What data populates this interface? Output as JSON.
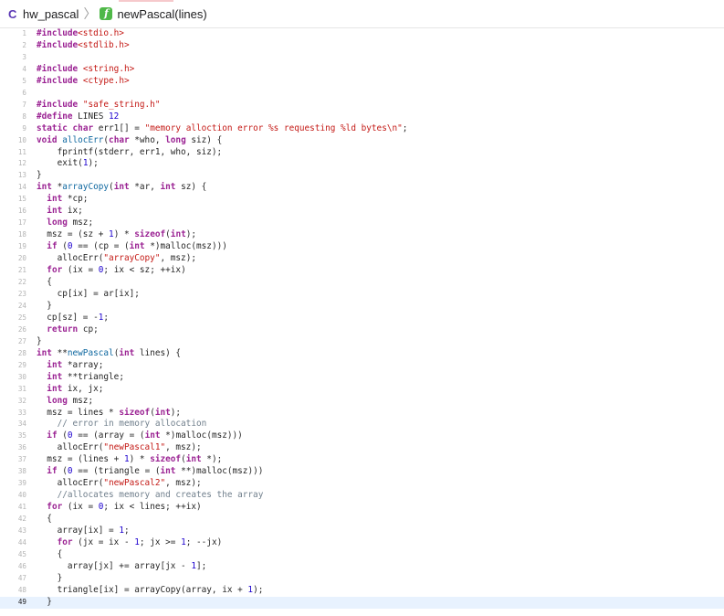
{
  "breadcrumb": {
    "file_icon": "c-file-icon",
    "file": "hw_pascal",
    "separator_icon": "chevron-right-icon",
    "function_icon": "function-icon",
    "function_icon_glyph": "f",
    "function": "newPascal(lines)"
  },
  "editor": {
    "current_line": 49,
    "lines": [
      {
        "n": "1",
        "t": "#include<stdio.h>"
      },
      {
        "n": "2",
        "t": "#include<stdlib.h>"
      },
      {
        "n": "3",
        "t": ""
      },
      {
        "n": "4",
        "t": "#include <string.h>"
      },
      {
        "n": "5",
        "t": "#include <ctype.h>"
      },
      {
        "n": "6",
        "t": ""
      },
      {
        "n": "7",
        "t": "#include \"safe_string.h\""
      },
      {
        "n": "8",
        "t": "#define LINES 12"
      },
      {
        "n": "9",
        "t": "static char err1[] = \"memory alloction error %s requesting %ld bytes\\n\";"
      },
      {
        "n": "10",
        "t": "void allocErr(char *who, long siz) {"
      },
      {
        "n": "11",
        "t": "    fprintf(stderr, err1, who, siz);"
      },
      {
        "n": "12",
        "t": "    exit(1);"
      },
      {
        "n": "13",
        "t": "}"
      },
      {
        "n": "14",
        "t": "int *arrayCopy(int *ar, int sz) {"
      },
      {
        "n": "15",
        "t": "  int *cp;"
      },
      {
        "n": "16",
        "t": "  int ix;"
      },
      {
        "n": "17",
        "t": "  long msz;"
      },
      {
        "n": "18",
        "t": "  msz = (sz + 1) * sizeof(int);"
      },
      {
        "n": "19",
        "t": "  if (0 == (cp = (int *)malloc(msz)))"
      },
      {
        "n": "20",
        "t": "    allocErr(\"arrayCopy\", msz);"
      },
      {
        "n": "21",
        "t": "  for (ix = 0; ix < sz; ++ix)"
      },
      {
        "n": "22",
        "t": "  {"
      },
      {
        "n": "23",
        "t": "    cp[ix] = ar[ix];"
      },
      {
        "n": "24",
        "t": "  }"
      },
      {
        "n": "25",
        "t": "  cp[sz] = -1;"
      },
      {
        "n": "26",
        "t": "  return cp;"
      },
      {
        "n": "27",
        "t": "}"
      },
      {
        "n": "28",
        "t": "int **newPascal(int lines) {"
      },
      {
        "n": "29",
        "t": "  int *array;"
      },
      {
        "n": "30",
        "t": "  int **triangle;"
      },
      {
        "n": "31",
        "t": "  int ix, jx;"
      },
      {
        "n": "32",
        "t": "  long msz;"
      },
      {
        "n": "33",
        "t": "  msz = lines * sizeof(int);"
      },
      {
        "n": "34",
        "t": "    // error in memory allocation"
      },
      {
        "n": "35",
        "t": "  if (0 == (array = (int *)malloc(msz)))"
      },
      {
        "n": "36",
        "t": "    allocErr(\"newPascal1\", msz);"
      },
      {
        "n": "37",
        "t": "  msz = (lines + 1) * sizeof(int *);"
      },
      {
        "n": "38",
        "t": "  if (0 == (triangle = (int **)malloc(msz)))"
      },
      {
        "n": "39",
        "t": "    allocErr(\"newPascal2\", msz);"
      },
      {
        "n": "40",
        "t": "    //allocates memory and creates the array"
      },
      {
        "n": "41",
        "t": "  for (ix = 0; ix < lines; ++ix)"
      },
      {
        "n": "42",
        "t": "  {"
      },
      {
        "n": "43",
        "t": "    array[ix] = 1;"
      },
      {
        "n": "44",
        "t": "    for (jx = ix - 1; jx >= 1; --jx)"
      },
      {
        "n": "45",
        "t": "    {"
      },
      {
        "n": "46",
        "t": "      array[jx] += array[jx - 1];"
      },
      {
        "n": "47",
        "t": "    }"
      },
      {
        "n": "48",
        "t": "    triangle[ix] = arrayCopy(array, ix + 1);"
      },
      {
        "n": "49",
        "t": "  }"
      }
    ]
  },
  "colors": {
    "keyword": "#9b2393",
    "string": "#c41a16",
    "number": "#1c00cf",
    "function_decl": "#0f68a0",
    "comment": "#707f8c",
    "current_line_bg": "#e8f2fe"
  }
}
